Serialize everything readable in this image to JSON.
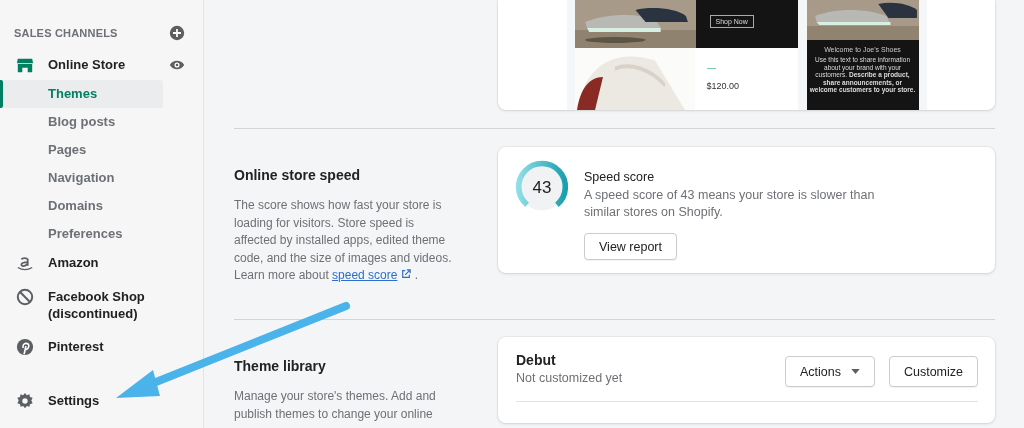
{
  "sidebar": {
    "section_title": "SALES CHANNELS",
    "items": [
      {
        "label": "Online Store",
        "kind": "store",
        "children": [
          {
            "label": "Themes",
            "selected": true
          },
          {
            "label": "Blog posts",
            "selected": false
          },
          {
            "label": "Pages",
            "selected": false
          },
          {
            "label": "Navigation",
            "selected": false
          },
          {
            "label": "Domains",
            "selected": false
          },
          {
            "label": "Preferences",
            "selected": false
          }
        ]
      },
      {
        "label": "Amazon",
        "kind": "amazon"
      },
      {
        "label": "Facebook Shop (discontinued)",
        "kind": "blocked"
      },
      {
        "label": "Pinterest",
        "kind": "pinterest"
      }
    ],
    "settings": {
      "label": "Settings"
    }
  },
  "preview": {
    "button": "Shop Now",
    "price": "$120.00",
    "welcome_title": "Welcome to Joe's Shoes",
    "welcome_text": "Use this text to share information about your brand with your customers. **Describe a product, share announcements, or welcome customers to your store.**"
  },
  "speed": {
    "title": "Online store speed",
    "description": "The score shows how fast your store is loading for visitors. Store speed is affected by installed apps, edited theme code, and the size of images and videos. Learn more about",
    "link": "speed score",
    "after_link": ".",
    "score": "43",
    "card_title": "Speed score",
    "card_text": "A speed score of 43 means your store is slower than similar stores on Shopify.",
    "button": "View report"
  },
  "library": {
    "title": "Theme library",
    "description": "Manage your store's themes. Add and publish themes to change your online",
    "themes": [
      {
        "name": "Debut",
        "status": "Not customized yet",
        "actions": "Actions",
        "customize": "Customize"
      }
    ]
  }
}
